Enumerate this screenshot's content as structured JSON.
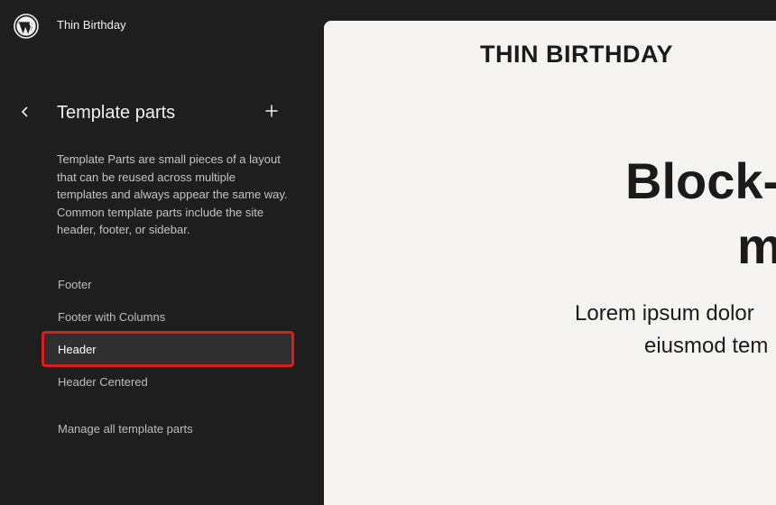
{
  "site": {
    "title": "Thin Birthday"
  },
  "panel": {
    "title": "Template parts",
    "description": "Template Parts are small pieces of a layout that can be reused across multiple templates and always appear the same way. Common template parts include the site header, footer, or sidebar.",
    "items": [
      {
        "label": "Footer"
      },
      {
        "label": "Footer with Columns"
      },
      {
        "label": "Header"
      },
      {
        "label": "Header Centered"
      }
    ],
    "active_index": 2,
    "manage_label": "Manage all template parts"
  },
  "preview": {
    "site_title": "THIN BIRTHDAY",
    "heading_line_1": "Block-",
    "heading_line_2": "m",
    "paragraph_line_1": "Lorem ipsum dolor",
    "paragraph_line_2": "eiusmod tem"
  },
  "icons": {
    "logo": "wordpress-logo-icon",
    "back": "chevron-left-icon",
    "add": "plus-icon"
  },
  "colors": {
    "sidebar_bg": "#1e1e1e",
    "preview_bg": "#f5f4f2",
    "highlight": "#e01b1b"
  }
}
